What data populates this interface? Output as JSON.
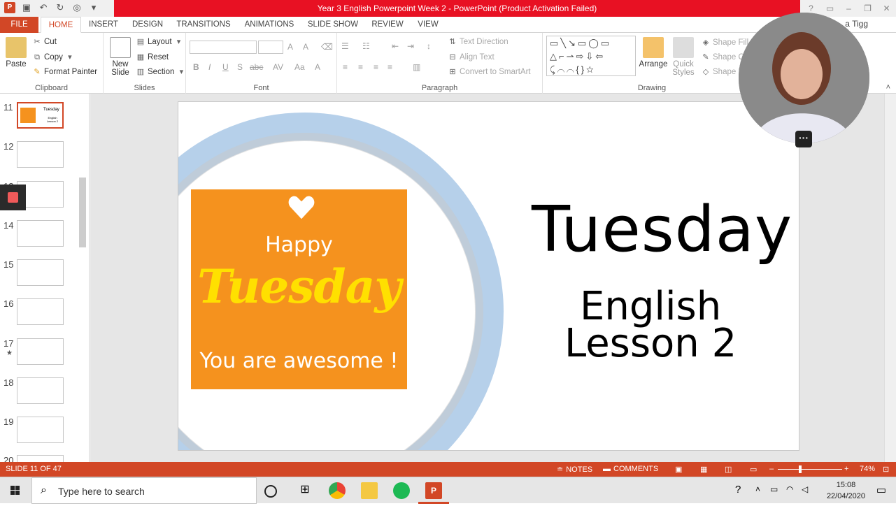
{
  "window": {
    "title": "Year 3 English Powerpoint Week 2 -  PowerPoint (Product Activation Failed)",
    "user": "a Tigg"
  },
  "tabs": [
    "FILE",
    "HOME",
    "INSERT",
    "DESIGN",
    "TRANSITIONS",
    "ANIMATIONS",
    "SLIDE SHOW",
    "REVIEW",
    "VIEW"
  ],
  "ribbon": {
    "clipboard": {
      "label": "Clipboard",
      "paste": "Paste",
      "cut": "Cut",
      "copy": "Copy",
      "format_painter": "Format Painter"
    },
    "slides": {
      "label": "Slides",
      "new_slide_1": "New",
      "new_slide_2": "Slide",
      "layout": "Layout",
      "reset": "Reset",
      "section": "Section"
    },
    "font": {
      "label": "Font"
    },
    "paragraph": {
      "label": "Paragraph",
      "text_direction": "Text Direction",
      "align_text": "Align Text",
      "convert_smartart": "Convert to SmartArt"
    },
    "drawing": {
      "label": "Drawing",
      "arrange": "Arrange",
      "quick_styles_1": "Quick",
      "quick_styles_2": "Styles",
      "shape_fill": "Shape Fill",
      "shape_outline": "Shape Ou",
      "shape_effects": "Shape Ef"
    }
  },
  "thumbnails": [
    {
      "num": "11",
      "selected": true
    },
    {
      "num": "12"
    },
    {
      "num": "13"
    },
    {
      "num": "14"
    },
    {
      "num": "15"
    },
    {
      "num": "16"
    },
    {
      "num": "17",
      "star": "★"
    },
    {
      "num": "18"
    },
    {
      "num": "19"
    },
    {
      "num": "20"
    }
  ],
  "slide": {
    "sticker_happy": "Happy",
    "sticker_tuesday": "Tuesday",
    "sticker_awesome": "You are awesome !",
    "title": "Tuesday",
    "subtitle_line1": "English",
    "subtitle_line2": "Lesson 2",
    "thumb_title": "Tuesday",
    "thumb_sub": "English Lesson 2"
  },
  "status": {
    "slide_info": "SLIDE 11 OF 47",
    "notes": "NOTES",
    "comments": "COMMENTS",
    "zoom": "74%"
  },
  "taskbar": {
    "search_placeholder": "Type here to search",
    "time": "15:08",
    "date": "22/04/2020"
  },
  "colors": {
    "accent": "#d24726",
    "title_bar_alert": "#e81123",
    "sticker_bg": "#f5921e",
    "sticker_yellow": "#ffe000"
  }
}
